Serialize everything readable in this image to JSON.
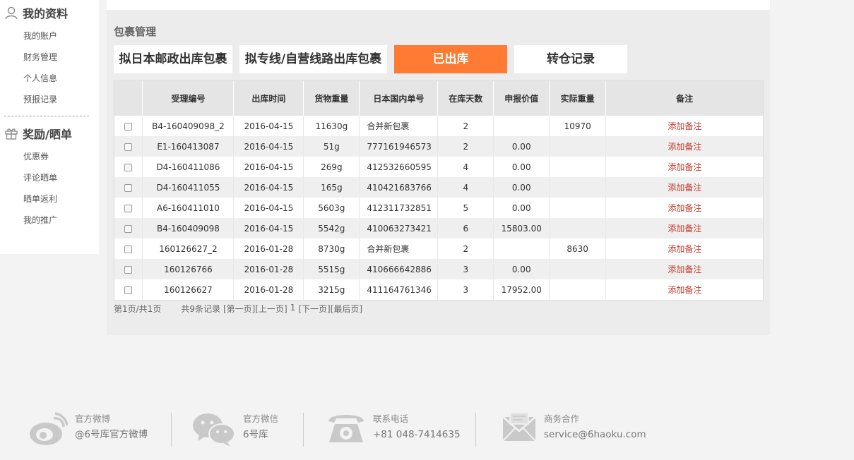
{
  "sidebar": {
    "section1": {
      "title": "我的资料",
      "icon": "user-icon"
    },
    "items1": [
      "我的账户",
      "财务管理",
      "个人信息",
      "预报记录"
    ],
    "section2": {
      "title": "奖励/晒单",
      "icon": "gift-icon"
    },
    "items2": [
      "优惠券",
      "评论晒单",
      "晒单返利",
      "我的推广"
    ]
  },
  "main": {
    "title": "包裹管理",
    "tabs": [
      {
        "label": "拟日本邮政出库包裹"
      },
      {
        "label": "拟专线/自营线路出库包裹"
      },
      {
        "label": "已出库"
      },
      {
        "label": "转仓记录"
      }
    ],
    "active_tab": 2,
    "accent_color": "#ff7a33"
  },
  "table": {
    "headers": [
      "",
      "受理编号",
      "出库时间",
      "货物重量",
      "日本国内单号",
      "在库天数",
      "申报价值",
      "实际重量",
      "备注"
    ],
    "rows": [
      {
        "id": "B4-160409098_2",
        "date": "2016-04-15",
        "weight": "11630g",
        "tracking": "合并新包裹",
        "days": "2",
        "value": "",
        "actual": "10970",
        "note": "添加备注"
      },
      {
        "id": "E1-160413087",
        "date": "2016-04-15",
        "weight": "51g",
        "tracking": "777161946573",
        "days": "2",
        "value": "0.00",
        "actual": "",
        "note": "添加备注"
      },
      {
        "id": "D4-160411086",
        "date": "2016-04-15",
        "weight": "269g",
        "tracking": "412532660595",
        "days": "4",
        "value": "0.00",
        "actual": "",
        "note": "添加备注"
      },
      {
        "id": "D4-160411055",
        "date": "2016-04-15",
        "weight": "165g",
        "tracking": "410421683766",
        "days": "4",
        "value": "0.00",
        "actual": "",
        "note": "添加备注"
      },
      {
        "id": "A6-160411010",
        "date": "2016-04-15",
        "weight": "5603g",
        "tracking": "412311732851",
        "days": "5",
        "value": "0.00",
        "actual": "",
        "note": "添加备注"
      },
      {
        "id": "B4-160409098",
        "date": "2016-04-15",
        "weight": "5542g",
        "tracking": "410063273421",
        "days": "6",
        "value": "15803.00",
        "actual": "",
        "note": "添加备注"
      },
      {
        "id": "160126627_2",
        "date": "2016-01-28",
        "weight": "8730g",
        "tracking": "合并新包裹",
        "days": "2",
        "value": "",
        "actual": "8630",
        "note": "添加备注"
      },
      {
        "id": "160126766",
        "date": "2016-01-28",
        "weight": "5515g",
        "tracking": "410666642886",
        "days": "3",
        "value": "0.00",
        "actual": "",
        "note": "添加备注"
      },
      {
        "id": "160126627",
        "date": "2016-01-28",
        "weight": "3215g",
        "tracking": "411164761346",
        "days": "3",
        "value": "17952.00",
        "actual": "",
        "note": "添加备注"
      }
    ]
  },
  "pager": {
    "page_info": "第1页/共1页",
    "total": "共9条记录",
    "first": "[第一页]",
    "prev": "[上一页]",
    "current": "1",
    "next": "[下一页]",
    "last": "[最后页]"
  },
  "footer": [
    {
      "icon": "weibo-icon",
      "label": "官方微博",
      "value": "@6号库官方微博"
    },
    {
      "icon": "wechat-icon",
      "label": "官方微信",
      "value": "6号库"
    },
    {
      "icon": "phone-icon",
      "label": "联系电话",
      "value": "+81 048-7414635"
    },
    {
      "icon": "mail-icon",
      "label": "商务合作",
      "value": "service@6haoku.com"
    }
  ]
}
